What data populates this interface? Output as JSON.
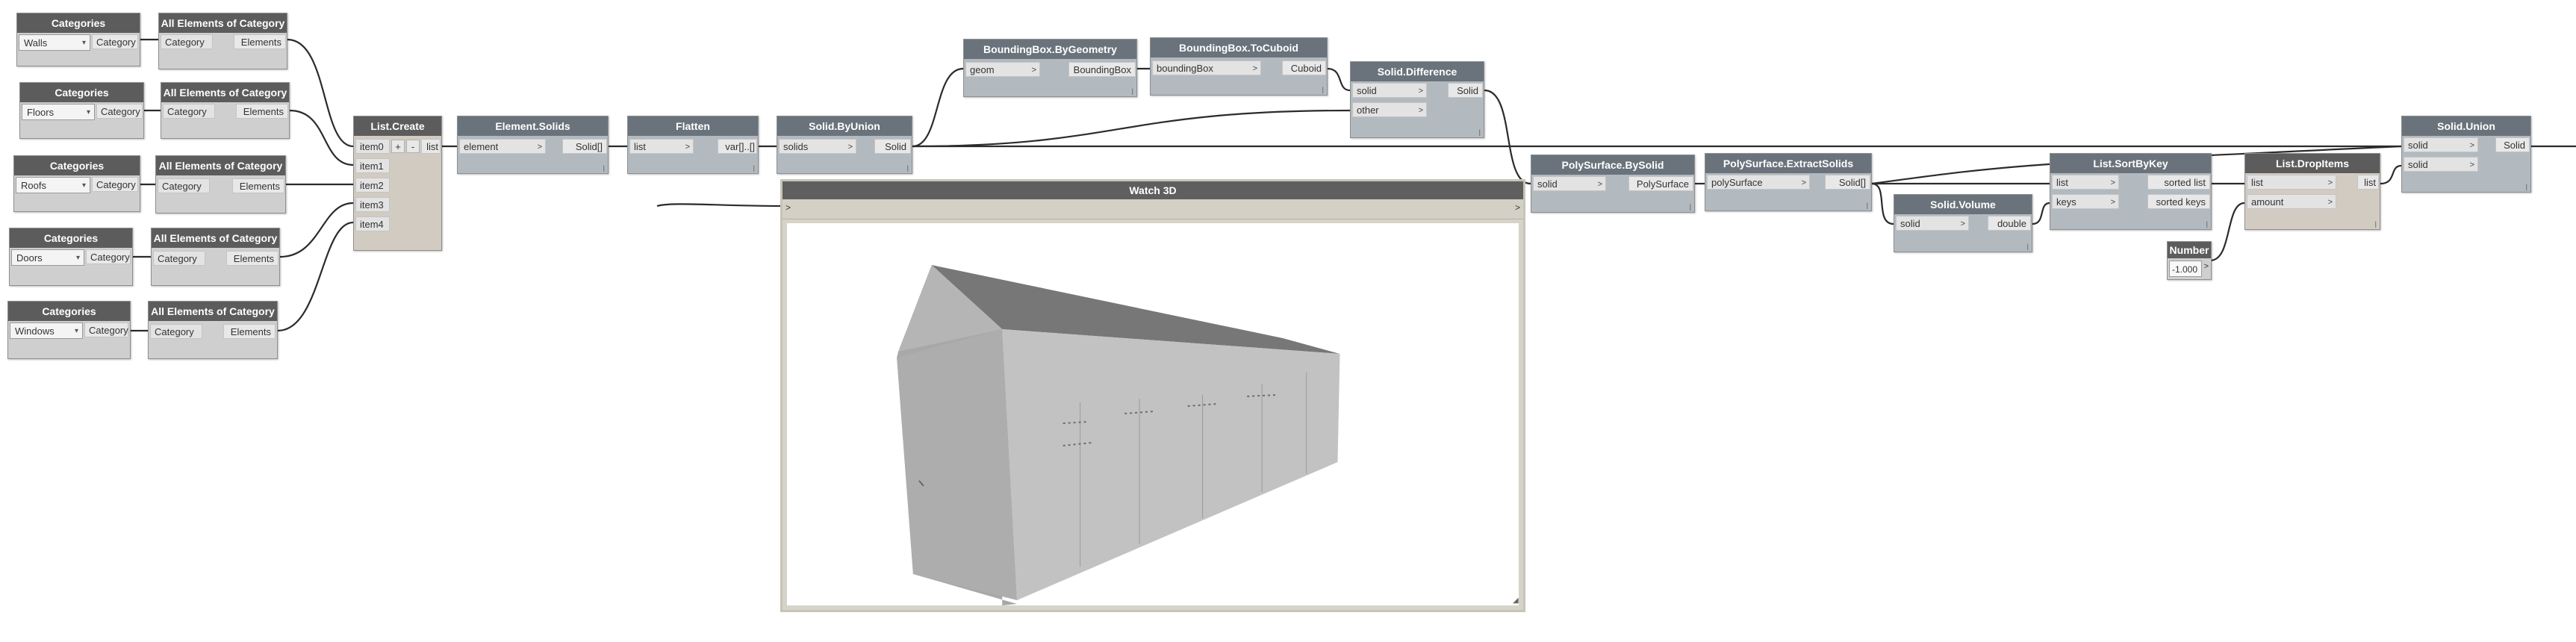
{
  "nodes": {
    "cat_walls": {
      "title": "Categories",
      "value": "Walls",
      "output": "Category"
    },
    "cat_floors": {
      "title": "Categories",
      "value": "Floors",
      "output": "Category"
    },
    "cat_roofs": {
      "title": "Categories",
      "value": "Roofs",
      "output": "Category"
    },
    "cat_doors": {
      "title": "Categories",
      "value": "Doors",
      "output": "Category"
    },
    "cat_windows": {
      "title": "Categories",
      "value": "Windows",
      "output": "Category"
    },
    "all_1": {
      "title": "All Elements of Category",
      "input": "Category",
      "output": "Elements"
    },
    "all_2": {
      "title": "All Elements of Category",
      "input": "Category",
      "output": "Elements"
    },
    "all_3": {
      "title": "All Elements of Category",
      "input": "Category",
      "output": "Elements"
    },
    "all_4": {
      "title": "All Elements of Category",
      "input": "Category",
      "output": "Elements"
    },
    "all_5": {
      "title": "All Elements of Category",
      "input": "Category",
      "output": "Elements"
    },
    "list_create": {
      "title": "List.Create",
      "inputs": [
        "item0",
        "item1",
        "item2",
        "item3",
        "item4"
      ],
      "plus": "+",
      "minus": "-",
      "output": "list"
    },
    "element_solids": {
      "title": "Element.Solids",
      "input": "element",
      "output": "Solid[]"
    },
    "flatten": {
      "title": "Flatten",
      "input": "list",
      "output": "var[]..[]"
    },
    "solid_byunion": {
      "title": "Solid.ByUnion",
      "input": "solids",
      "output": "Solid"
    },
    "bbox_bygeom": {
      "title": "BoundingBox.ByGeometry",
      "input": "geom",
      "output": "BoundingBox"
    },
    "bbox_tocuboid": {
      "title": "BoundingBox.ToCuboid",
      "input": "boundingBox",
      "output": "Cuboid"
    },
    "solid_difference": {
      "title": "Solid.Difference",
      "inputs": [
        "solid",
        "other"
      ],
      "output": "Solid"
    },
    "polysurface_bysolid": {
      "title": "PolySurface.BySolid",
      "input": "solid",
      "output": "PolySurface"
    },
    "polysurface_extract": {
      "title": "PolySurface.ExtractSolids",
      "input": "polySurface",
      "output": "Solid[]"
    },
    "solid_volume": {
      "title": "Solid.Volume",
      "input": "solid",
      "output": "double"
    },
    "list_sortbykey": {
      "title": "List.SortByKey",
      "inputs": [
        "list",
        "keys"
      ],
      "outputs": [
        "sorted list",
        "sorted keys"
      ]
    },
    "number": {
      "title": "Number",
      "value": "-1.000"
    },
    "list_dropitems": {
      "title": "List.DropItems",
      "inputs": [
        "list",
        "amount"
      ],
      "output": "list"
    },
    "solid_union": {
      "title": "Solid.Union",
      "inputs": [
        "solid",
        "solid"
      ],
      "output": "Solid"
    }
  },
  "watch3d": {
    "title": "Watch 3D",
    "in_marker": ">",
    "out_marker": ">"
  },
  "colors": {
    "wire": "#2b2b2b",
    "node_header": "#5c5c5c",
    "node_header_blue": "#6a737b",
    "canvas": "#ffffff"
  }
}
